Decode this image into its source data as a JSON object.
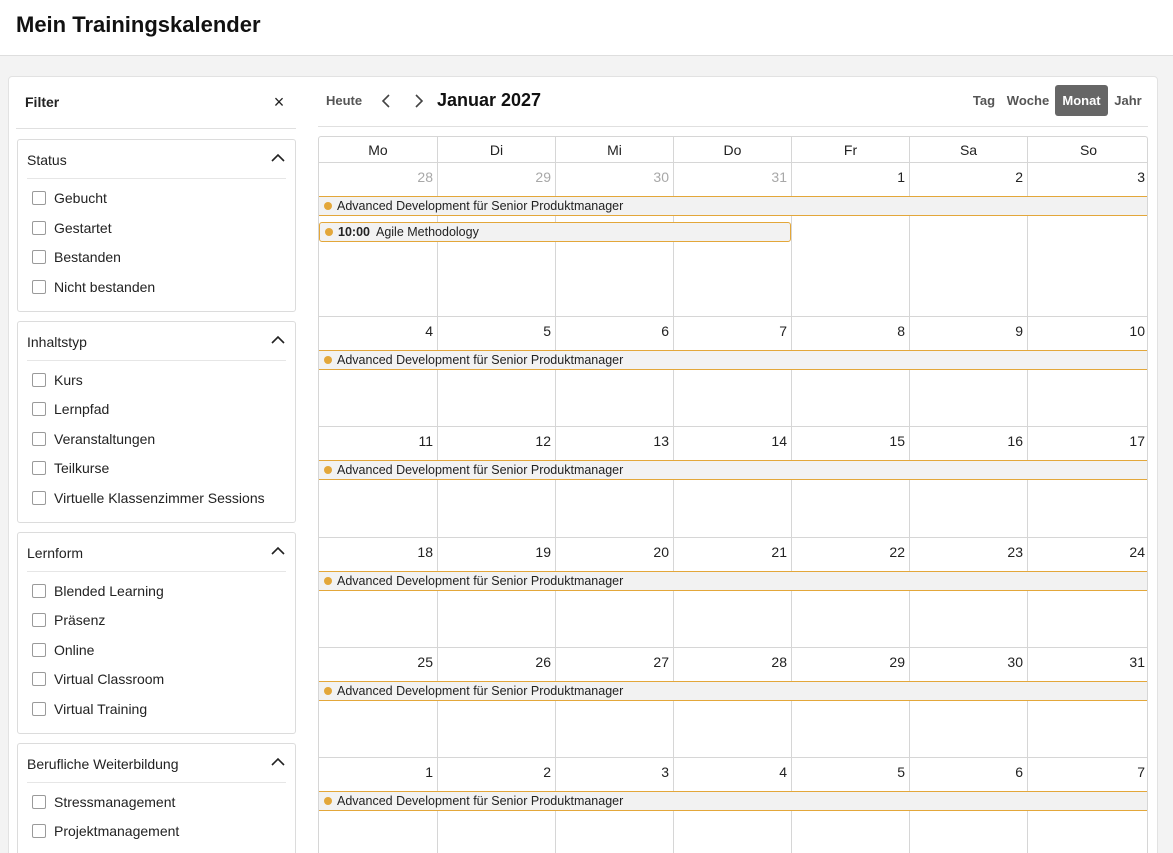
{
  "page": {
    "title": "Mein Trainingskalender"
  },
  "filter": {
    "title": "Filter",
    "close_symbol": "×",
    "sections": [
      {
        "title": "Status",
        "options": [
          "Gebucht",
          "Gestartet",
          "Bestanden",
          "Nicht bestanden"
        ]
      },
      {
        "title": "Inhaltstyp",
        "options": [
          "Kurs",
          "Lernpfad",
          "Veranstaltungen",
          "Teilkurse",
          "Virtuelle Klassenzimmer Sessions"
        ]
      },
      {
        "title": "Lernform",
        "options": [
          "Blended Learning",
          "Präsenz",
          "Online",
          "Virtual Classroom",
          "Virtual Training"
        ]
      },
      {
        "title": "Berufliche Weiterbildung",
        "options": [
          "Stressmanagement",
          "Projektmanagement"
        ]
      }
    ]
  },
  "toolbar": {
    "today_label": "Heute",
    "month_title": "Januar 2027",
    "views": [
      {
        "label": "Tag",
        "active": false
      },
      {
        "label": "Woche",
        "active": false
      },
      {
        "label": "Monat",
        "active": true
      },
      {
        "label": "Jahr",
        "active": false
      }
    ]
  },
  "calendar": {
    "weekdays": [
      "Mo",
      "Di",
      "Mi",
      "Do",
      "Fr",
      "Sa",
      "So"
    ],
    "weeks": [
      {
        "days": [
          "28",
          "29",
          "30",
          "31",
          "1",
          "2",
          "3"
        ],
        "muted": [
          true,
          true,
          true,
          true,
          false,
          false,
          false
        ]
      },
      {
        "days": [
          "4",
          "5",
          "6",
          "7",
          "8",
          "9",
          "10"
        ],
        "muted": [
          false,
          false,
          false,
          false,
          false,
          false,
          false
        ]
      },
      {
        "days": [
          "11",
          "12",
          "13",
          "14",
          "15",
          "16",
          "17"
        ],
        "muted": [
          false,
          false,
          false,
          false,
          false,
          false,
          false
        ]
      },
      {
        "days": [
          "18",
          "19",
          "20",
          "21",
          "22",
          "23",
          "24"
        ],
        "muted": [
          false,
          false,
          false,
          false,
          false,
          false,
          false
        ]
      },
      {
        "days": [
          "25",
          "26",
          "27",
          "28",
          "29",
          "30",
          "31"
        ],
        "muted": [
          false,
          false,
          false,
          false,
          false,
          false,
          false
        ]
      },
      {
        "days": [
          "1",
          "2",
          "3",
          "4",
          "5",
          "6",
          "7"
        ],
        "muted": [
          false,
          false,
          false,
          false,
          false,
          false,
          false
        ]
      }
    ],
    "recurring_event": "Advanced Development für Senior Produktmanager",
    "single_event": {
      "time": "10:00",
      "title": "Agile Methodology"
    },
    "event_color": "#e3a73a",
    "muted_color": "#a8a8a8"
  }
}
